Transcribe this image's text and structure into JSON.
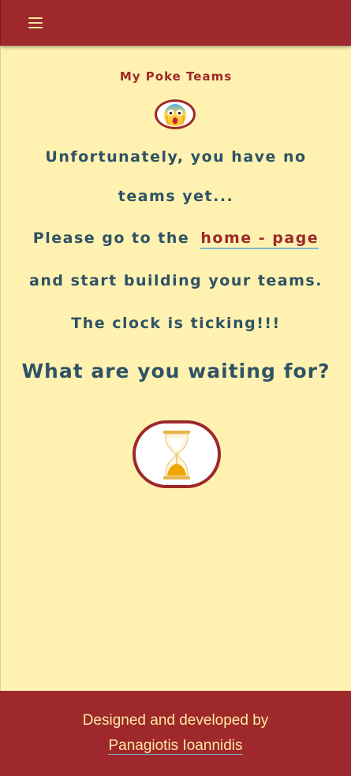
{
  "header": {
    "menu_icon": "hamburger-menu-icon",
    "background_color": "#9e282b"
  },
  "page": {
    "title": "My Poke Teams",
    "emoji_icon": "screaming-face-emoji-icon",
    "message_line1": "Unfortunately, you have no",
    "message_line2": "teams yet...",
    "message_line3_prefix": "Please go to the",
    "home_link_label": "home - page",
    "message_line4": "and start building your teams.",
    "message_line5": "The clock is ticking!!!",
    "message_line6": "What are you waiting for?",
    "hourglass_icon": "hourglass-icon",
    "background_color": "#fff2b0",
    "text_color": "#2f5266",
    "accent_color": "#9e282b"
  },
  "footer": {
    "credit_text": "Designed and developed by",
    "author_name": "Panagiotis Ioannidis"
  }
}
